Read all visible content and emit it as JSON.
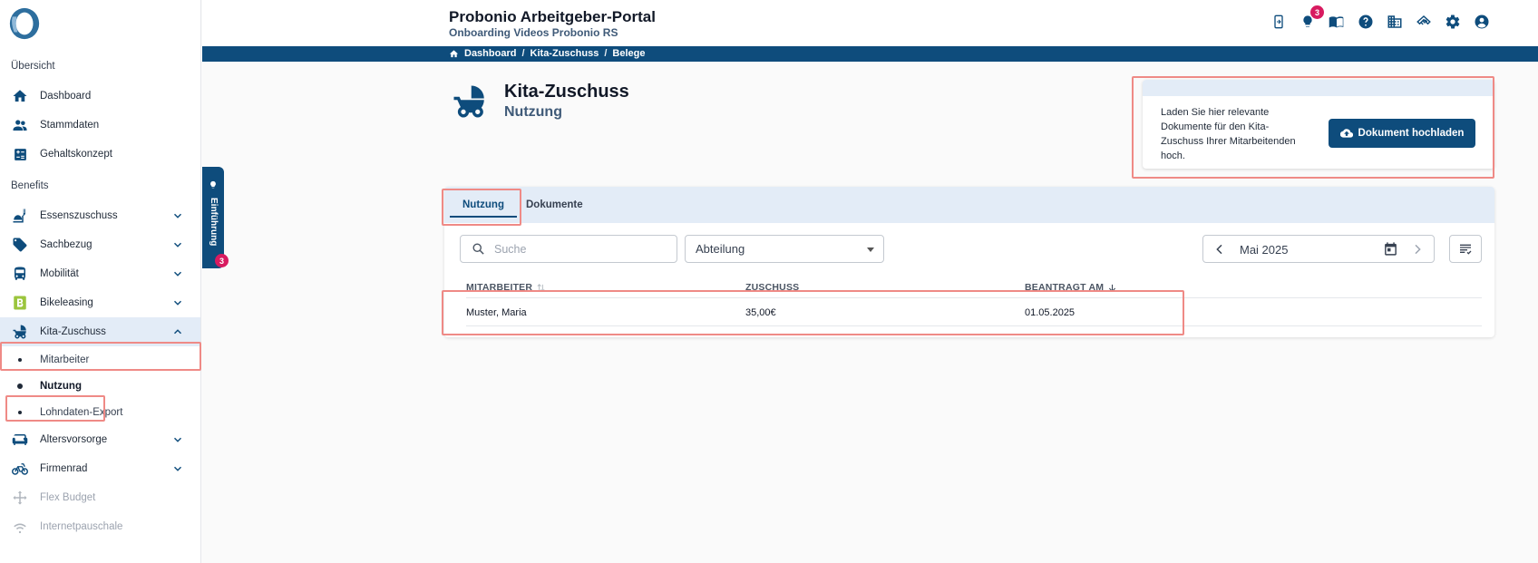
{
  "app": {
    "title": "Probonio Arbeitgeber-Portal",
    "subtitle": "Onboarding Videos Probonio RS",
    "notification_count": "3"
  },
  "breadcrumb": [
    "Dashboard",
    "Kita-Zuschuss",
    "Belege"
  ],
  "sidebar": {
    "section_overview": "Übersicht",
    "section_benefits": "Benefits",
    "overview_items": [
      {
        "label": "Dashboard",
        "icon": "home-icon"
      },
      {
        "label": "Stammdaten",
        "icon": "people-icon"
      },
      {
        "label": "Gehaltskonzept",
        "icon": "calculator-icon"
      }
    ],
    "benefit_items": [
      {
        "label": "Essenszuschuss",
        "icon": "food-icon"
      },
      {
        "label": "Sachbezug",
        "icon": "tag-icon"
      },
      {
        "label": "Mobilität",
        "icon": "bus-icon"
      },
      {
        "label": "Bikeleasing",
        "icon": "bikeleasing-icon"
      },
      {
        "label": "Kita-Zuschuss",
        "icon": "stroller-icon"
      }
    ],
    "kita_subitems": [
      "Mitarbeiter",
      "Nutzung",
      "Lohndaten-Export"
    ],
    "more_items": [
      {
        "label": "Altersvorsorge",
        "icon": "sofa-icon"
      },
      {
        "label": "Firmenrad",
        "icon": "bike-icon"
      },
      {
        "label": "Flex Budget",
        "icon": "arrows-icon"
      },
      {
        "label": "Internetpauschale",
        "icon": "wifi-icon"
      }
    ]
  },
  "intro": {
    "label": "Einführung",
    "count": "3"
  },
  "page": {
    "title": "Kita-Zuschuss",
    "subtitle": "Nutzung"
  },
  "upload": {
    "text": "Laden Sie hier relevante Dokumente für den Kita-Zuschuss Ihrer Mitarbeitenden hoch.",
    "button_label": "Dokument hochladen"
  },
  "tabs": [
    "Nutzung",
    "Dokumente"
  ],
  "filters": {
    "search_placeholder": "Suche",
    "department_label": "Abteilung",
    "month": "Mai 2025"
  },
  "table": {
    "columns": [
      "MITARBEITER",
      "ZUSCHUSS",
      "BEANTRAGT AM"
    ],
    "rows": [
      [
        "Muster, Maria",
        "35,00€",
        "01.05.2025"
      ]
    ]
  },
  "colors": {
    "primary": "#0e4c7c",
    "accent_badge": "#d81b60",
    "highlight": "#ef8a86",
    "tab_bg": "#e3ecf7"
  }
}
